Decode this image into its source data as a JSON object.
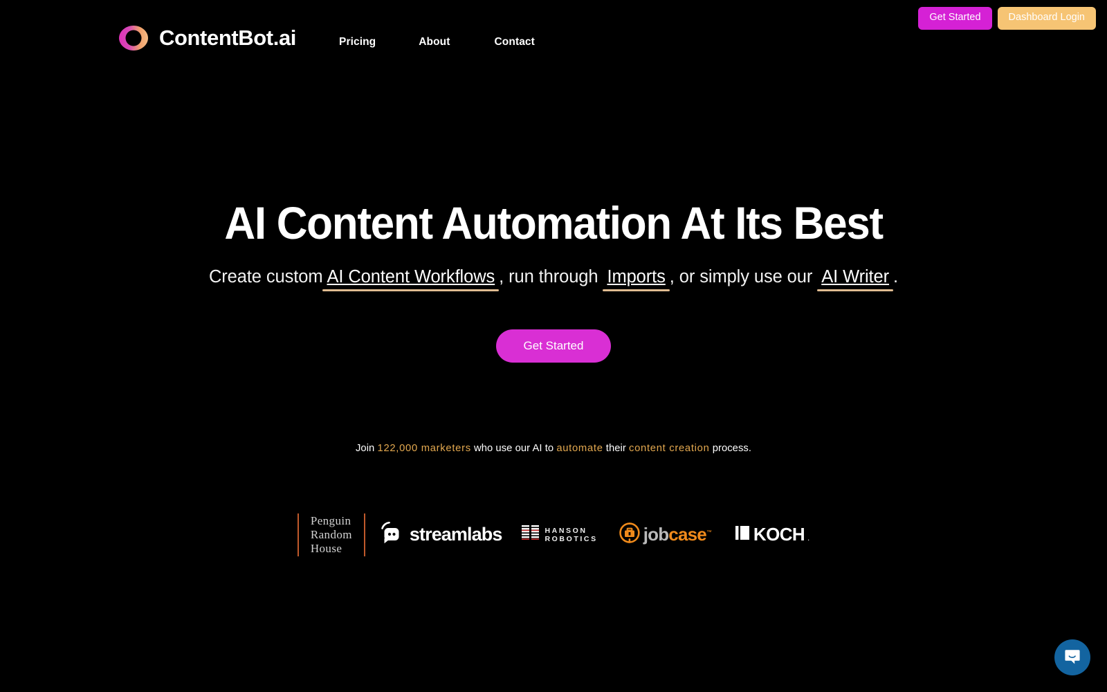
{
  "theme": {
    "background": "#000000",
    "accent_magenta": "#d92fd4",
    "accent_amber": "#f6c474",
    "underline": "#e0bc91",
    "highlight_text": "#e3a84f",
    "chat_blue": "#1364a0",
    "rule_orange": "#c0592b"
  },
  "header": {
    "brand": {
      "name": "ContentBot.ai",
      "logo_icon": "gradient-ring-icon"
    },
    "nav": [
      {
        "label": "Pricing"
      },
      {
        "label": "About"
      },
      {
        "label": "Contact"
      }
    ],
    "buttons": {
      "get_started": "Get Started",
      "dashboard_login": "Dashboard Login"
    }
  },
  "hero": {
    "title": "AI Content Automation At Its Best",
    "subheadline": {
      "part1": "Create custom",
      "link1": "AI Content Workflows",
      "part2": ", run through",
      "link2": "Imports",
      "part3": ", or simply use our",
      "link3": "AI Writer",
      "part4": "."
    },
    "cta_button": "Get Started",
    "social_proof": {
      "prefix": "Join",
      "count": "122,000 marketers",
      "middle": "who use our AI to",
      "highlight1": "automate",
      "middle2": "their",
      "highlight2": "content creation",
      "suffix": "process."
    }
  },
  "logos": [
    {
      "name": "Penguin Random House",
      "line1": "Penguin",
      "line2": "Random",
      "line3": "House"
    },
    {
      "name": "Streamlabs",
      "wordmark": "streamlabs",
      "icon": "streamlabs-mascot-icon"
    },
    {
      "name": "Hanson Robotics",
      "line1": "HANSON",
      "line2": "ROBOTICS",
      "icon": "hanson-bars-icon"
    },
    {
      "name": "Jobcase",
      "word1": "job",
      "word2": "case",
      "tm": "™",
      "icon": "jobcase-briefcase-icon"
    },
    {
      "name": "Koch",
      "wordmark": "KOCH",
      "dot": ".",
      "icon": "koch-mark-icon"
    }
  ],
  "chat": {
    "label": "Open chat",
    "icon": "chat-bubble-icon"
  }
}
